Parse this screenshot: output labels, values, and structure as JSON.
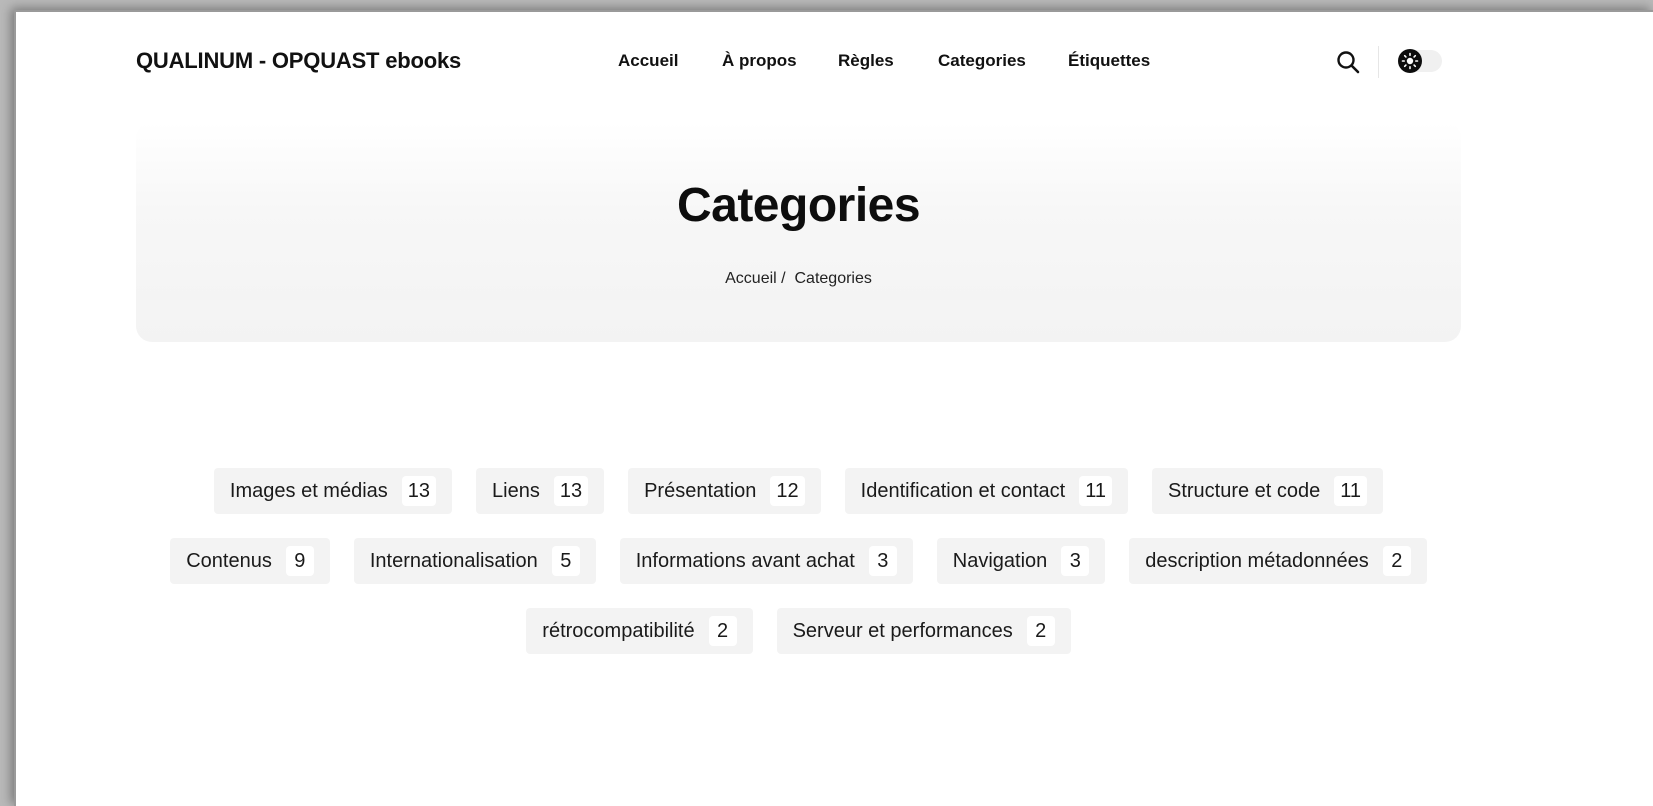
{
  "header": {
    "brand": "QUALINUM - OPQUAST ebooks",
    "nav": [
      {
        "label": "Accueil"
      },
      {
        "label": "À propos"
      },
      {
        "label": "Règles"
      },
      {
        "label": "Categories"
      },
      {
        "label": "Étiquettes"
      }
    ],
    "search_icon": "search-icon",
    "theme_toggle_icon": "sun-icon"
  },
  "hero": {
    "title": "Categories",
    "breadcrumb": {
      "home": "Accueil",
      "separator": "/",
      "current": "Categories"
    }
  },
  "categories": [
    {
      "name": "Images et médias",
      "count": "13"
    },
    {
      "name": "Liens",
      "count": "13"
    },
    {
      "name": "Présentation",
      "count": "12"
    },
    {
      "name": "Identification et contact",
      "count": "11"
    },
    {
      "name": "Structure et code",
      "count": "11"
    },
    {
      "name": "Contenus",
      "count": "9"
    },
    {
      "name": "Internationalisation",
      "count": "5"
    },
    {
      "name": "Informations avant achat",
      "count": "3"
    },
    {
      "name": "Navigation",
      "count": "3"
    },
    {
      "name": "description métadonnées",
      "count": "2"
    },
    {
      "name": "rétrocompatibilité",
      "count": "2"
    },
    {
      "name": "Serveur et performances",
      "count": "2"
    }
  ],
  "colors": {
    "tag_background": "#f3f3f3",
    "count_background": "#ffffff",
    "text": "#111111"
  }
}
